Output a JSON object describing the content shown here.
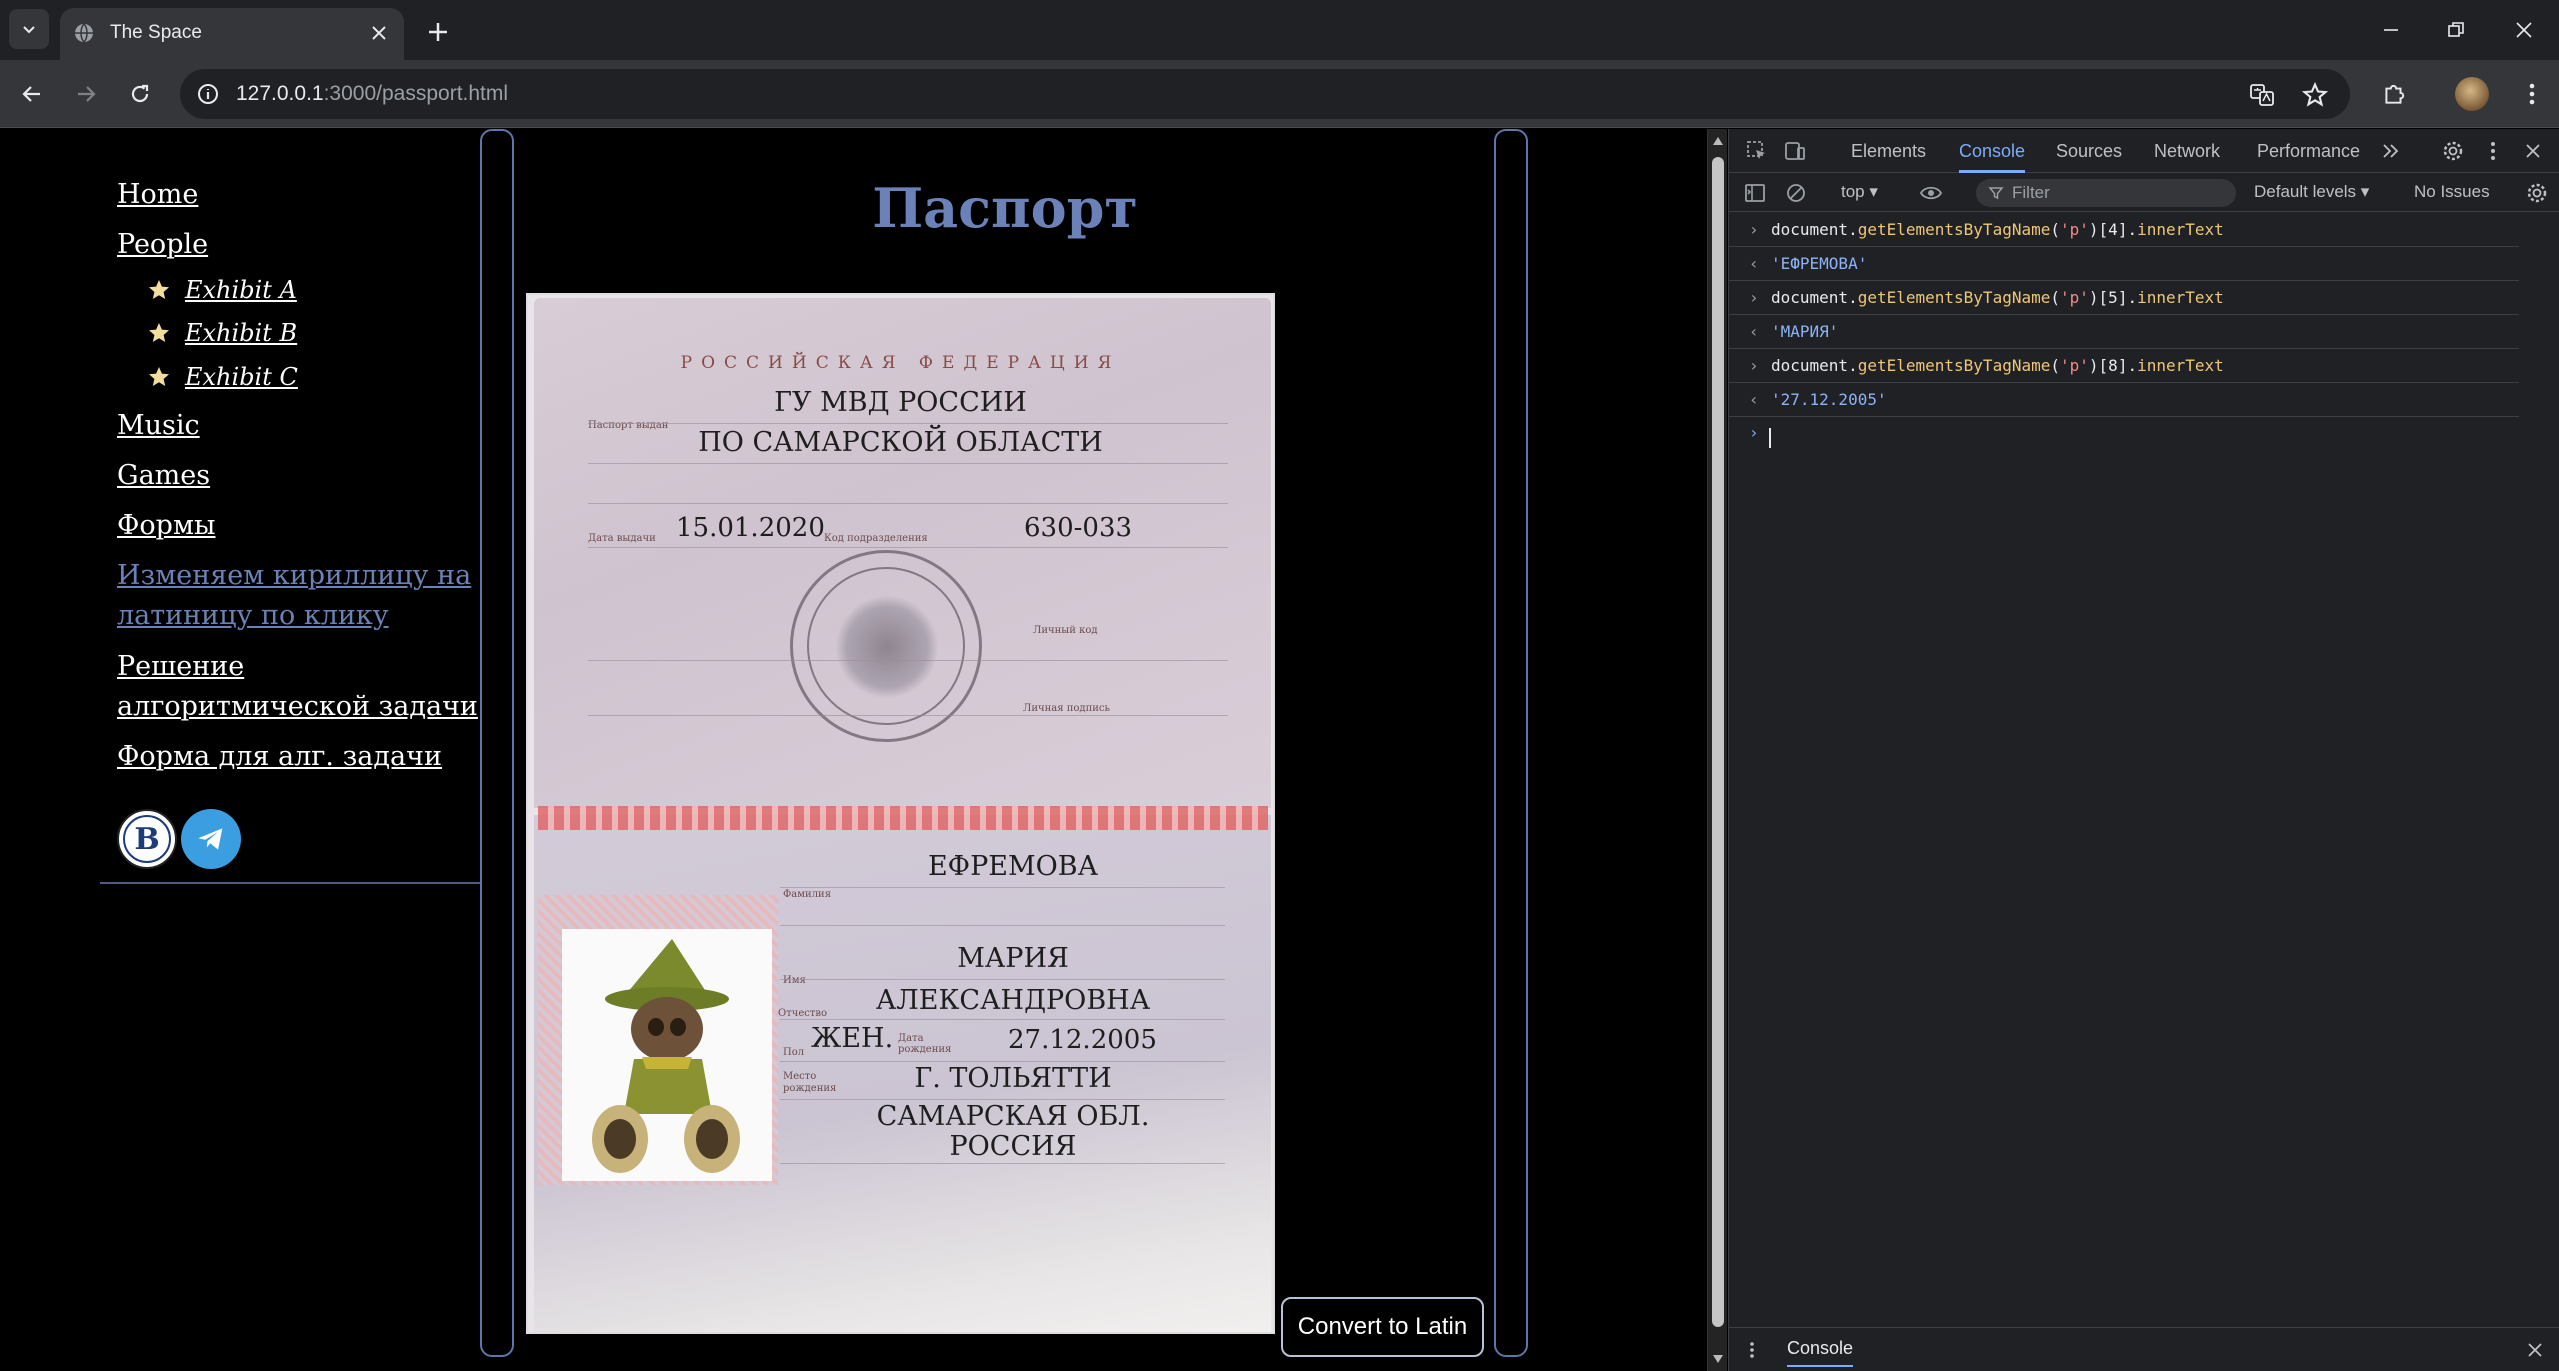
{
  "browser": {
    "tab_title": "The Space",
    "url_host": "127.0.0.1",
    "url_rest": ":3000/passport.html"
  },
  "nav": {
    "home": "Home",
    "people": "People",
    "exhibits": [
      "Exhibit A",
      "Exhibit B",
      "Exhibit C"
    ],
    "music": "Music",
    "games": "Games",
    "forms": "Формы",
    "cyrillic_line1": "Изменяем кириллицу на",
    "cyrillic_line2": "латиницу по клику",
    "algo_line1": "Решение",
    "algo_line2": "алгоритмической задачи",
    "algo_form": "Форма для алг. задачи"
  },
  "page": {
    "title": "Паспорт",
    "convert_button": "Convert to Latin"
  },
  "passport": {
    "country": "РОССИЙСКАЯ ФЕДЕРАЦИЯ",
    "issued_by_label": "Паспорт выдан",
    "issued_by_line1": "ГУ МВД РОССИИ",
    "issued_by_line2": "ПО САМАРСКОЙ ОБЛАСТИ",
    "issue_date_label": "Дата выдачи",
    "issue_date": "15.01.2020",
    "code_label": "Код подразделения",
    "code": "630-033",
    "personal_code_label": "Личный код",
    "signature_label": "Личная подпись",
    "surname_label": "Фамилия",
    "surname": "ЕФРЕМОВА",
    "name_label": "Имя",
    "name": "МАРИЯ",
    "patronymic_label": "Отчество",
    "patronymic": "АЛЕКСАНДРОВНА",
    "sex_label": "Пол",
    "sex": "ЖЕН.",
    "birth_date_label": "Дата рождения",
    "birth_date": "27.12.2005",
    "birth_place_label": "Место рождения",
    "birth_place_line1": "Г. ТОЛЬЯТТИ",
    "birth_place_line2": "САМАРСКАЯ ОБЛ.",
    "birth_place_line3": "РОССИЯ"
  },
  "devtools": {
    "tabs": [
      "Elements",
      "Console",
      "Sources",
      "Network",
      "Performance"
    ],
    "context": "top",
    "filter_placeholder": "Filter",
    "levels": "Default levels",
    "issues": "No Issues",
    "console_rows": [
      {
        "type": "input",
        "obj": "document",
        "method": "getElementsByTagName",
        "arg": "'p'",
        "index": "[4]",
        "prop": "innerText"
      },
      {
        "type": "output",
        "value": "'ЕФРЕМОВА'"
      },
      {
        "type": "input",
        "obj": "document",
        "method": "getElementsByTagName",
        "arg": "'p'",
        "index": "[5]",
        "prop": "innerText"
      },
      {
        "type": "output",
        "value": "'МАРИЯ'"
      },
      {
        "type": "input",
        "obj": "document",
        "method": "getElementsByTagName",
        "arg": "'p'",
        "index": "[8]",
        "prop": "innerText"
      },
      {
        "type": "output",
        "value": "'27.12.2005'"
      }
    ],
    "drawer_tab": "Console"
  }
}
